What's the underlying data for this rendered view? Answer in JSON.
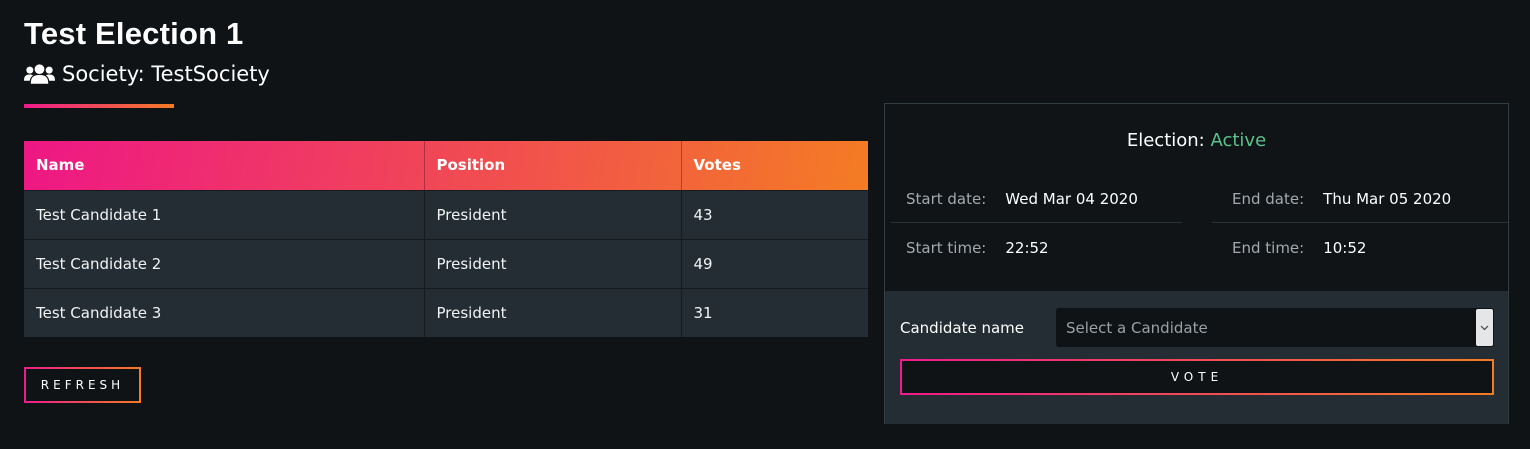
{
  "header": {
    "title": "Test Election 1",
    "society_label": "Society: TestSociety",
    "society_icon": "users-icon",
    "accent_gradient": [
      "#ed1b8b",
      "#f47c24"
    ]
  },
  "table": {
    "columns": [
      "Name",
      "Position",
      "Votes"
    ],
    "rows": [
      [
        "Test Candidate 1",
        "President",
        "43"
      ],
      [
        "Test Candidate 2",
        "President",
        "49"
      ],
      [
        "Test Candidate 3",
        "President",
        "31"
      ]
    ]
  },
  "actions": {
    "refresh_label": "REFRESH"
  },
  "election": {
    "status_prefix": "Election: ",
    "status": "Active",
    "status_color": "#5cc28a",
    "start_date_label": "Start date:",
    "start_date": "Wed Mar 04 2020",
    "end_date_label": "End date:",
    "end_date": "Thu Mar 05 2020",
    "start_time_label": "Start time:",
    "start_time": "22:52",
    "end_time_label": "End time:",
    "end_time": "10:52"
  },
  "vote": {
    "candidate_label": "Candidate name",
    "select_placeholder": "Select a Candidate",
    "vote_label": "VOTE"
  }
}
